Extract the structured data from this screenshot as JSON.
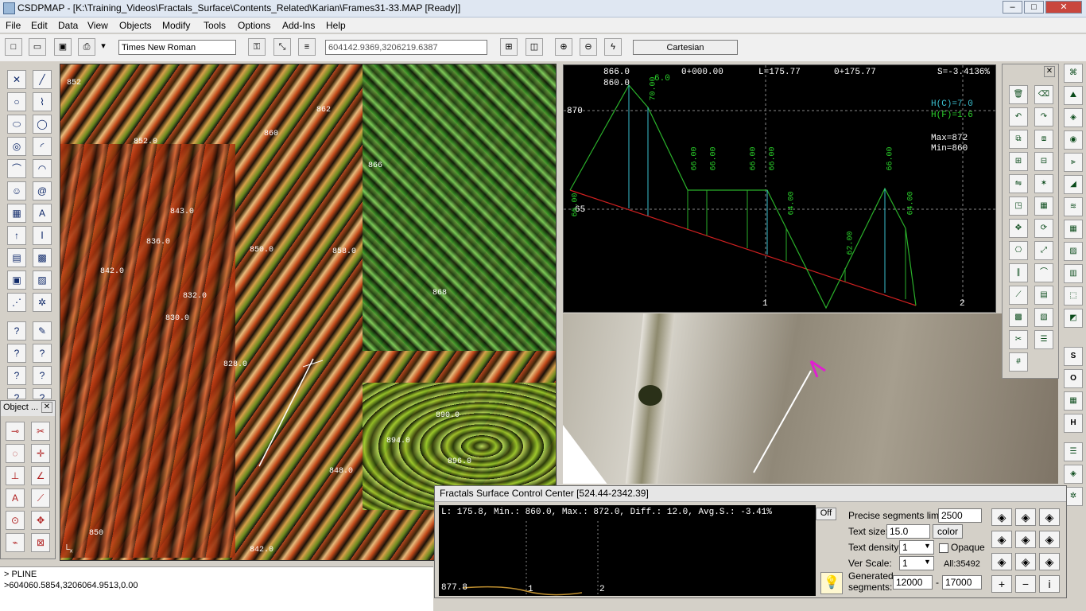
{
  "titlebar": {
    "title": "CSDPMAP - [K:\\Training_Videos\\Fractals_Surface\\Contents_Related\\Karian\\Frames31-33.MAP [Ready]]",
    "min_label": "–",
    "max_label": "□",
    "close_label": "✕"
  },
  "menu": [
    "File",
    "Edit",
    "Data",
    "View",
    "Objects",
    "Modify",
    "Tools",
    "Options",
    "Add-Ins",
    "Help"
  ],
  "toolbar": {
    "font_name": "Times New Roman",
    "coords": "604142.9369,3206219.6387",
    "projection": "Cartesian"
  },
  "object_panel": {
    "title": "Object ...",
    "close": "✕"
  },
  "map_labels": [
    "852",
    "852.0",
    "842.0",
    "843.0",
    "836.0",
    "850.0",
    "842.0",
    "832.0",
    "830.0",
    "828.0",
    "862",
    "860",
    "866",
    "868",
    "890.0",
    "894.0",
    "896.0",
    "848.0",
    "850",
    "858.0"
  ],
  "profile": {
    "top_labels": [
      "866.0",
      "860.0",
      "6.0",
      "0+000.00",
      "L=175.77",
      "0+175.77",
      "S=-3.4136%"
    ],
    "h_labels": [
      "H(C)=7.0",
      "H(F)=1.6"
    ],
    "minmax": [
      "Max=872",
      "Min=860"
    ],
    "y_labels": [
      "870",
      "65"
    ],
    "x_labels": [
      "1",
      "2"
    ],
    "vertical_values": [
      "66.00",
      "66.00",
      "66.00",
      "66.00",
      "64.00",
      "62.00",
      "66.00",
      "64.00",
      "70.00",
      "66.00"
    ]
  },
  "fcc": {
    "title": "Fractals Surface Control Center [524.44-2342.39]",
    "stats": "L: 175.8, Min.: 860.0, Max.: 872.0, Diff.: 12.0, Avg.S.: -3.41%",
    "off_label": "Off",
    "axis_start": "877.8",
    "axis_marks": [
      "1",
      "2"
    ],
    "precise_label": "Precise segments limit:",
    "precise_value": "2500",
    "text_size_label": "Text size:",
    "text_size_value": "15.0",
    "color_label": "color",
    "text_density_label": "Text density:",
    "text_density_value": "1",
    "opaque_label": "Opaque",
    "ver_scale_label": "Ver Scale:",
    "ver_scale_value": "1",
    "all_label": "All:35492",
    "generated_label": "Generated",
    "segments_label": "segments:",
    "gen_from": "12000",
    "gen_sep": "-",
    "gen_to": "17000",
    "plus": "+",
    "minus": "−",
    "info": "i"
  },
  "command": [
    "> PLINE",
    ">604060.5854,3206064.9513,0.00"
  ],
  "farright_letters": [
    "S",
    "O",
    "H"
  ]
}
